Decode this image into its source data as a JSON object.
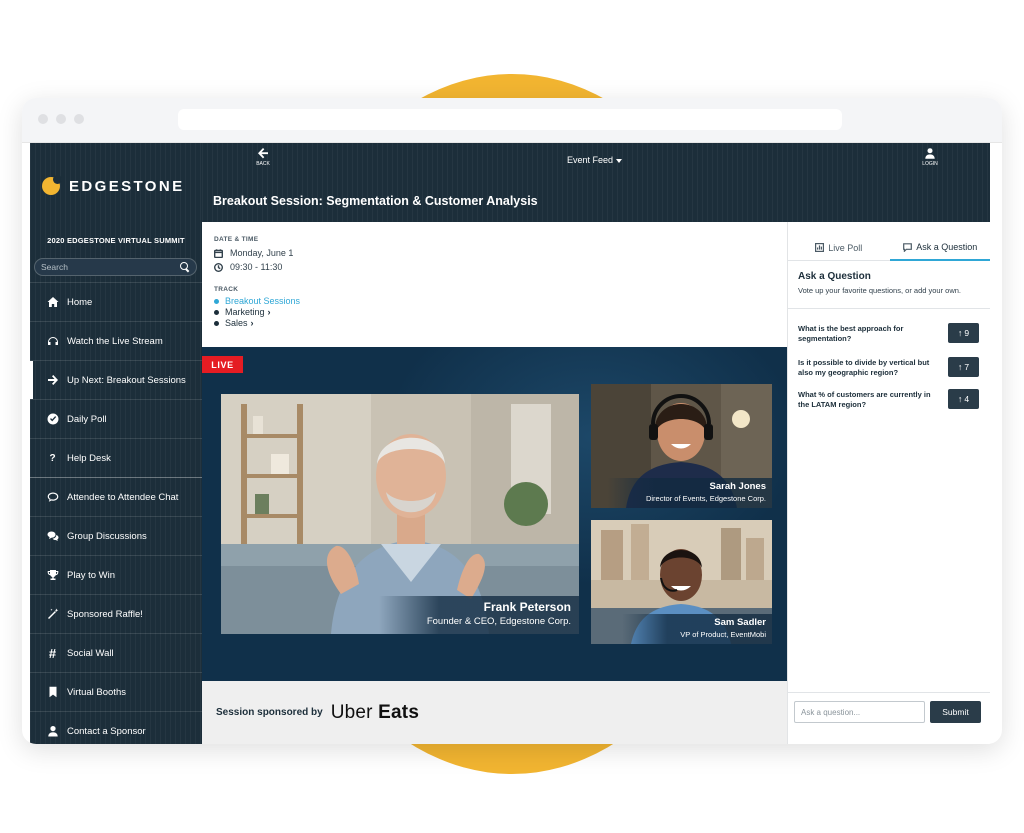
{
  "brand": {
    "name": "EDGESTONE",
    "event": "2020 EDGESTONE VIRTUAL SUMMIT",
    "accent": "#f2b531",
    "navy": "#1c2e3a"
  },
  "search": {
    "placeholder": "Search"
  },
  "nav": [
    {
      "label": "Home",
      "icon": "home-icon"
    },
    {
      "label": "Watch the Live Stream",
      "icon": "headphones-icon"
    },
    {
      "label": "Up Next: Breakout Sessions",
      "icon": "arrow-right-icon"
    },
    {
      "label": "Daily Poll",
      "icon": "check-circle-icon"
    },
    {
      "label": "Help Desk",
      "icon": "question-icon"
    },
    {
      "label": "Attendee to Attendee Chat",
      "icon": "chat-bubble-icon"
    },
    {
      "label": "Group Discussions",
      "icon": "discussion-icon"
    },
    {
      "label": "Play to Win",
      "icon": "trophy-icon"
    },
    {
      "label": "Sponsored Raffle!",
      "icon": "magic-wand-icon"
    },
    {
      "label": "Social Wall",
      "icon": "hashtag-icon"
    },
    {
      "label": "Virtual Booths",
      "icon": "bookmark-icon"
    },
    {
      "label": "Contact a Sponsor",
      "icon": "user-icon"
    }
  ],
  "header": {
    "back": "BACK",
    "feed": "Event Feed",
    "login": "LOGIN",
    "title": "Breakout Session: Segmentation & Customer Analysis"
  },
  "details": {
    "date_label": "DATE & TIME",
    "date": "Monday, June 1",
    "time": "09:30 - 11:30",
    "track_label": "TRACK",
    "tracks": [
      "Breakout Sessions",
      "Marketing",
      "Sales"
    ]
  },
  "video": {
    "live": "LIVE",
    "speakers": [
      {
        "name": "Frank Peterson",
        "role": "Founder & CEO, Edgestone Corp."
      },
      {
        "name": "Sarah Jones",
        "role": "Director of Events, Edgestone Corp."
      },
      {
        "name": "Sam Sadler",
        "role": "VP of Product, EventMobi"
      }
    ]
  },
  "sponsor": {
    "label": "Session sponsored by",
    "name_1": "Uber",
    "name_2": "Eats"
  },
  "panel": {
    "tab_poll": "Live Poll",
    "tab_ask": "Ask a Question",
    "heading": "Ask a Question",
    "subheading": "Vote up your favorite questions, or add your own.",
    "questions": [
      {
        "text": "What is the best approach for segmentation?",
        "votes": "9"
      },
      {
        "text": "Is it possible to divide by vertical but also my geographic region?",
        "votes": "7"
      },
      {
        "text": "What % of customers are currently in the LATAM region?",
        "votes": "4"
      }
    ],
    "input_placeholder": "Ask a question...",
    "submit": "Submit"
  }
}
